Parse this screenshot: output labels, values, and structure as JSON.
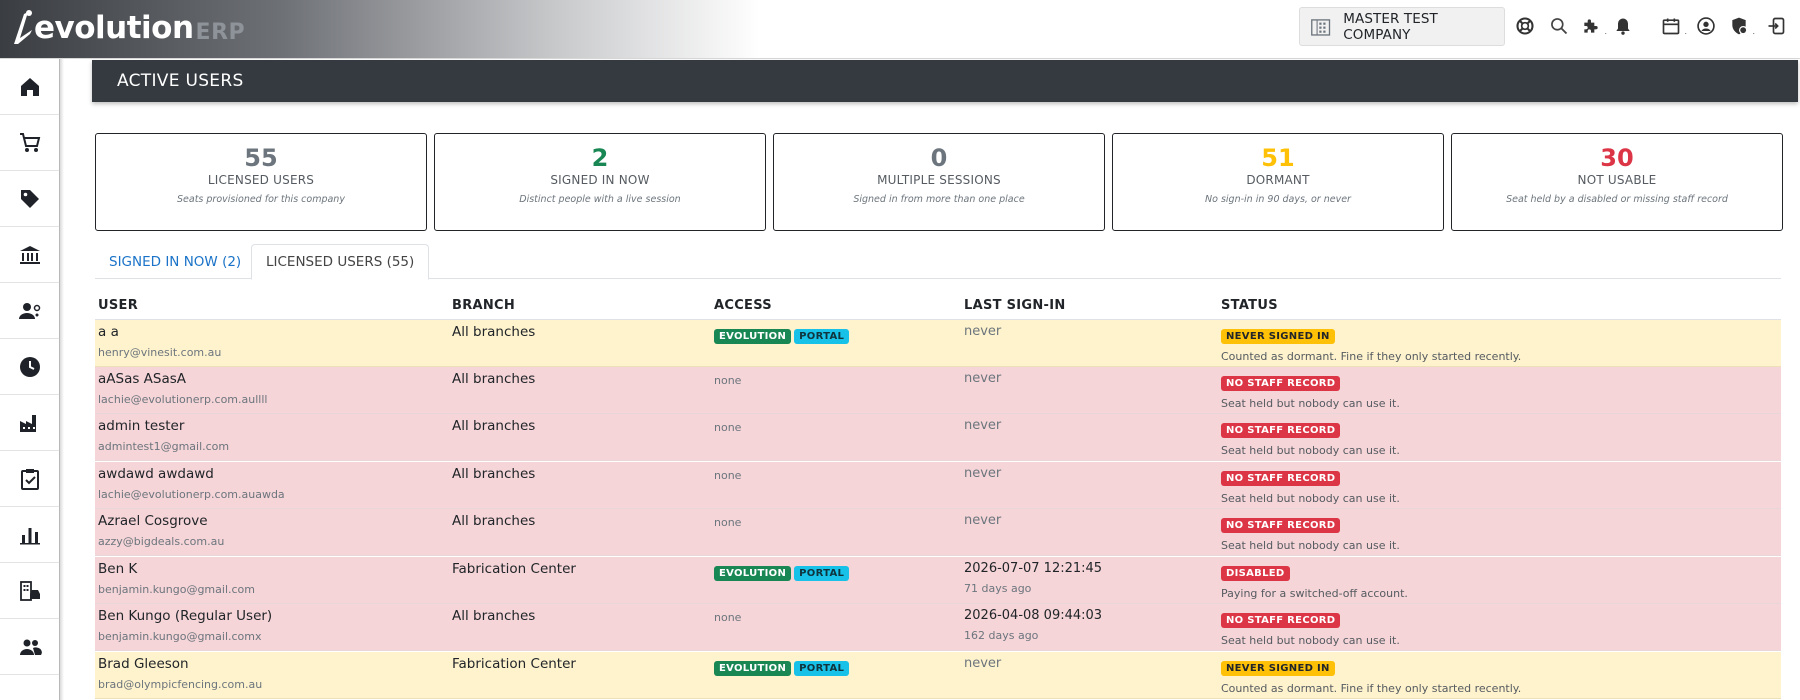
{
  "app": {
    "logo_main": "evolution",
    "logo_suffix": "ERP",
    "company": "MASTER TEST COMPANY"
  },
  "topbar": {
    "icons": [
      "help-icon",
      "search-icon",
      "extension-icon",
      "bell-icon",
      "calendar-icon",
      "user-icon",
      "shield-icon",
      "logout-icon"
    ]
  },
  "sidebar": {
    "items": [
      "home-icon",
      "cart-icon",
      "tag-icon",
      "bank-icon",
      "staff-icon",
      "clock-icon",
      "factory-icon",
      "clipboard-check-icon",
      "bar-chart-icon",
      "building-car-icon",
      "people-icon"
    ]
  },
  "page": {
    "title": "ACTIVE USERS"
  },
  "stats": [
    {
      "value": "55",
      "label": "LICENSED USERS",
      "sub": "Seats provisioned for this company",
      "color": "#6c757d"
    },
    {
      "value": "2",
      "label": "SIGNED IN NOW",
      "sub": "Distinct people with a live session",
      "color": "#198754"
    },
    {
      "value": "0",
      "label": "MULTIPLE SESSIONS",
      "sub": "Signed in from more than one place",
      "color": "#6c757d"
    },
    {
      "value": "51",
      "label": "DORMANT",
      "sub": "No sign-in in 90 days, or never",
      "color": "#ffc107"
    },
    {
      "value": "30",
      "label": "NOT USABLE",
      "sub": "Seat held by a disabled or missing staff record",
      "color": "#dc3545"
    }
  ],
  "tabs": [
    {
      "label": "SIGNED IN NOW (2)",
      "active": false
    },
    {
      "label": "LICENSED USERS (55)",
      "active": true
    }
  ],
  "table": {
    "headers": [
      "USER",
      "BRANCH",
      "ACCESS",
      "LAST SIGN-IN",
      "STATUS"
    ],
    "rows": [
      {
        "name": "a a",
        "email": "henry@vinesit.com.au",
        "branch": "All branches",
        "access": [
          "EVOLUTION",
          "PORTAL"
        ],
        "none": "",
        "last": "never",
        "ago": "",
        "status": "NEVER SIGNED IN",
        "note": "Counted as dormant. Fine if they only started recently.",
        "tone": "yellow"
      },
      {
        "name": "aASas ASasA",
        "email": "lachie@evolutionerp.com.aullll",
        "branch": "All branches",
        "access": [],
        "none": "none",
        "last": "never",
        "ago": "",
        "status": "NO STAFF RECORD",
        "note": "Seat held but nobody can use it.",
        "tone": "red"
      },
      {
        "name": "admin tester",
        "email": "admintest1@gmail.com",
        "branch": "All branches",
        "access": [],
        "none": "none",
        "last": "never",
        "ago": "",
        "status": "NO STAFF RECORD",
        "note": "Seat held but nobody can use it.",
        "tone": "red"
      },
      {
        "name": "awdawd awdawd",
        "email": "lachie@evolutionerp.com.auawda",
        "branch": "All branches",
        "access": [],
        "none": "none",
        "last": "never",
        "ago": "",
        "status": "NO STAFF RECORD",
        "note": "Seat held but nobody can use it.",
        "tone": "red"
      },
      {
        "name": "Azrael Cosgrove",
        "email": "azzy@bigdeals.com.au",
        "branch": "All branches",
        "access": [],
        "none": "none",
        "last": "never",
        "ago": "",
        "status": "NO STAFF RECORD",
        "note": "Seat held but nobody can use it.",
        "tone": "red"
      },
      {
        "name": "Ben K",
        "email": "benjamin.kungo@gmail.com",
        "branch": "Fabrication Center",
        "access": [
          "EVOLUTION",
          "PORTAL"
        ],
        "none": "",
        "last": "2026-07-07 12:21:45",
        "ago": "71 days ago",
        "status": "DISABLED",
        "note": "Paying for a switched-off account.",
        "tone": "red"
      },
      {
        "name": "Ben Kungo (Regular User)",
        "email": "benjamin.kungo@gmail.comx",
        "branch": "All branches",
        "access": [],
        "none": "none",
        "last": "2026-04-08 09:44:03",
        "ago": "162 days ago",
        "status": "NO STAFF RECORD",
        "note": "Seat held but nobody can use it.",
        "tone": "red"
      },
      {
        "name": "Brad Gleeson",
        "email": "brad@olympicfencing.com.au",
        "branch": "Fabrication Center",
        "access": [
          "EVOLUTION",
          "PORTAL"
        ],
        "none": "",
        "last": "never",
        "ago": "",
        "status": "NEVER SIGNED IN",
        "note": "Counted as dormant. Fine if they only started recently.",
        "tone": "yellow"
      }
    ]
  }
}
